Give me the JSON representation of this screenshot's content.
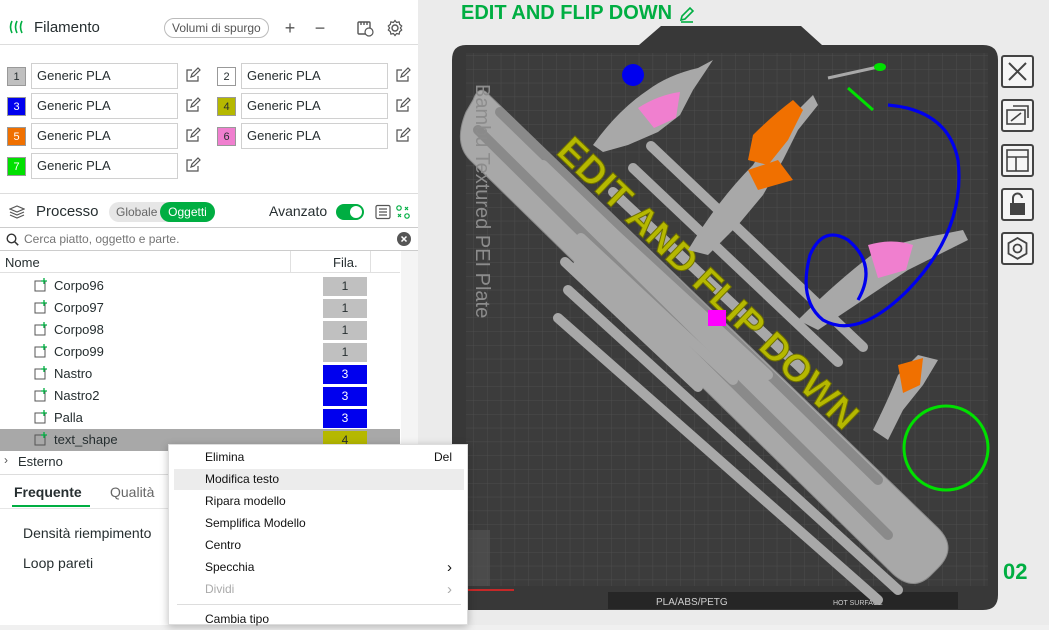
{
  "filament": {
    "title": "Filamento",
    "purge_label": "Volumi di spurgo",
    "plus": "+",
    "minus": "−",
    "slots": [
      {
        "num": "1",
        "name": "Generic PLA",
        "color": "#c0c0c0",
        "text_color": "#262e30"
      },
      {
        "num": "2",
        "name": "Generic PLA",
        "color": "#ffffff",
        "text_color": "#262e30"
      },
      {
        "num": "3",
        "name": "Generic PLA",
        "color": "#0000ee",
        "text_color": "#ffffff"
      },
      {
        "num": "4",
        "name": "Generic PLA",
        "color": "#b5b800",
        "text_color": "#262e30"
      },
      {
        "num": "5",
        "name": "Generic PLA",
        "color": "#f07000",
        "text_color": "#ffffff"
      },
      {
        "num": "6",
        "name": "Generic PLA",
        "color": "#f07fcf",
        "text_color": "#262e30"
      },
      {
        "num": "7",
        "name": "Generic PLA",
        "color": "#00e000",
        "text_color": "#ffffff"
      }
    ]
  },
  "process": {
    "title": "Processo",
    "toggle_global": "Globale",
    "toggle_objects": "Oggetti",
    "advanced_label": "Avanzato",
    "advanced_on": true
  },
  "search": {
    "placeholder": "Cerca piatto, oggetto e parte."
  },
  "table": {
    "col_name": "Nome",
    "col_fila": "Fila.",
    "rows": [
      {
        "name": "Corpo96",
        "fila": "1",
        "color": "#c0c0c0",
        "text_color": "#262e30",
        "selected": false
      },
      {
        "name": "Corpo97",
        "fila": "1",
        "color": "#c0c0c0",
        "text_color": "#262e30",
        "selected": false
      },
      {
        "name": "Corpo98",
        "fila": "1",
        "color": "#c0c0c0",
        "text_color": "#262e30",
        "selected": false
      },
      {
        "name": "Corpo99",
        "fila": "1",
        "color": "#c0c0c0",
        "text_color": "#262e30",
        "selected": false
      },
      {
        "name": "Nastro",
        "fila": "3",
        "color": "#0000ee",
        "text_color": "#ffffff",
        "selected": false
      },
      {
        "name": "Nastro2",
        "fila": "3",
        "color": "#0000ee",
        "text_color": "#ffffff",
        "selected": false
      },
      {
        "name": "Palla",
        "fila": "3",
        "color": "#0000ee",
        "text_color": "#ffffff",
        "selected": false
      },
      {
        "name": "text_shape",
        "fila": "4",
        "color": "#b5b800",
        "text_color": "#262e30",
        "selected": true
      }
    ],
    "external": "Esterno"
  },
  "tabs": {
    "frequent": "Frequente",
    "quality": "Qualità"
  },
  "settings": {
    "infill_density": "Densità riempimento",
    "wall_loops": "Loop pareti"
  },
  "context_menu": [
    {
      "label": "Elimina",
      "accel": "Del",
      "disabled": false,
      "submenu": false,
      "hover": false
    },
    {
      "label": "Modifica testo",
      "accel": "",
      "disabled": false,
      "submenu": false,
      "hover": true
    },
    {
      "label": "Ripara modello",
      "accel": "",
      "disabled": false,
      "submenu": false,
      "hover": false
    },
    {
      "label": "Semplifica Modello",
      "accel": "",
      "disabled": false,
      "submenu": false,
      "hover": false
    },
    {
      "label": "Centro",
      "accel": "",
      "disabled": false,
      "submenu": false,
      "hover": false
    },
    {
      "label": "Specchia",
      "accel": "",
      "disabled": false,
      "submenu": true,
      "hover": false
    },
    {
      "label": "Dividi",
      "accel": "",
      "disabled": true,
      "submenu": true,
      "hover": false
    },
    {
      "label": "Cambia tipo",
      "accel": "",
      "disabled": false,
      "submenu": false,
      "hover": false
    }
  ],
  "viewport": {
    "plate_name": "EDIT AND FLIP DOWN",
    "plate_number": "02",
    "model_text": "EDIT AND FLIP DOWN",
    "plate_brand_text": "Bambu Textured PEI Plate",
    "plate_footer": "PLA/ABS/PETG",
    "hot_surface": "HOT SURFACE",
    "accent": "#00ae42"
  }
}
